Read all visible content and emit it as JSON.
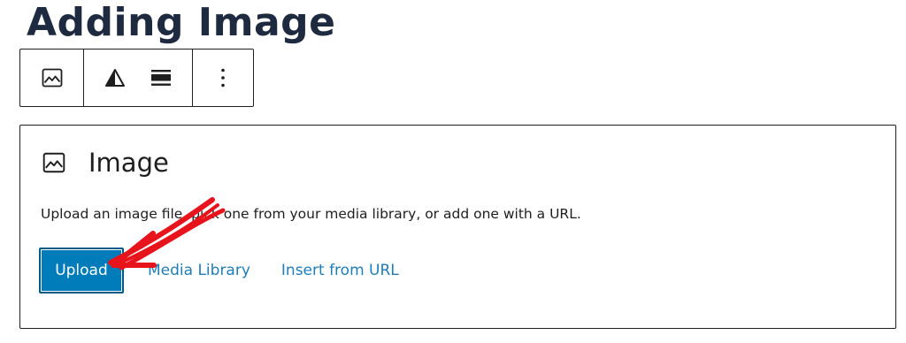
{
  "page": {
    "title": "Adding Image"
  },
  "toolbar": {
    "buttons": [
      {
        "name": "image-block-icon",
        "icon": "image"
      },
      {
        "name": "alignment-icon",
        "icon": "triangle-half"
      },
      {
        "name": "align-wide-icon",
        "icon": "align-bars"
      },
      {
        "name": "more-options-icon",
        "icon": "vertical-ellipsis"
      }
    ]
  },
  "block": {
    "label": "Image",
    "label_icon": "image",
    "instructions": "Upload an image file, pick one from your media library, or add one with a URL.",
    "upload_label": "Upload",
    "media_library_label": "Media Library",
    "insert_url_label": "Insert from URL"
  },
  "colors": {
    "title": "#1e2a3f",
    "border": "#1e1e1e",
    "primary": "#007cba",
    "link": "#1f7db8",
    "annotation": "#e8141c"
  }
}
